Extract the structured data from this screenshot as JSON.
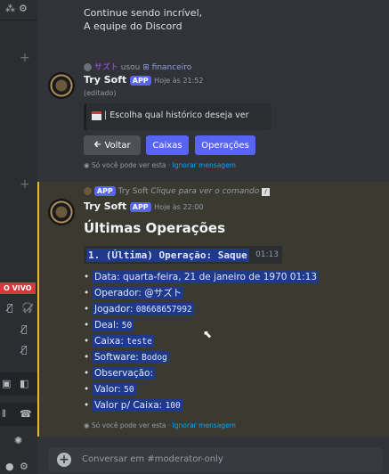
{
  "top_message": {
    "line1": "Continue sendo incrível,",
    "line2": "A equipe do Discord"
  },
  "reply_ref": {
    "user": "サズト",
    "action": "usou",
    "command": "financeiro"
  },
  "message1": {
    "author": "Try Soft",
    "badge": "APP",
    "time": "Hoje às 21:52",
    "edited": "(editado)",
    "embed_text": "| Escolha qual histórico deseja ver",
    "buttons": {
      "back": "Voltar",
      "caixas": "Caixas",
      "operacoes": "Operações"
    },
    "ephemeral": {
      "text": "Só você pode ver esta ·",
      "link": "Ignorar mensagem"
    }
  },
  "interaction_ref": {
    "badge": "APP",
    "author": "Try Soft",
    "text": "Clique para ver o comando"
  },
  "message2": {
    "author": "Try Soft",
    "badge": "APP",
    "time": "Hoje às 22:00",
    "heading": "Últimas Operações",
    "op_title": "1. (Última) Operação: Saque",
    "op_time_shadow": "01:13",
    "fields": [
      {
        "label": "Data:",
        "value": "quarta-feira, 21 de janeiro de 1970 01:13",
        "mono": false
      },
      {
        "label": "Operador:",
        "value": "@サズト",
        "mono": false
      },
      {
        "label": "Jogador:",
        "value": "08668657992",
        "mono": true
      },
      {
        "label": "Deal:",
        "value": "50",
        "mono": true
      },
      {
        "label": "Caixa:",
        "value": "teste",
        "mono": true
      },
      {
        "label": "Software:",
        "value": "Bodog",
        "mono": true
      },
      {
        "label": "Observação:",
        "value": "",
        "mono": false
      },
      {
        "label": "Valor:",
        "value": "50",
        "mono": true
      },
      {
        "label": "Valor p/ Caixa:",
        "value": "100",
        "mono": true
      }
    ],
    "ephemeral": {
      "text": "Só você pode ver esta ·",
      "link": "Ignorar mensagem"
    }
  },
  "composer": {
    "placeholder": "Conversar em #moderator-only"
  },
  "live_badge": "O VIVO",
  "colors": {
    "blurple": "#5865f2",
    "live": "#da373c",
    "highlight": "#1f3a8a"
  }
}
